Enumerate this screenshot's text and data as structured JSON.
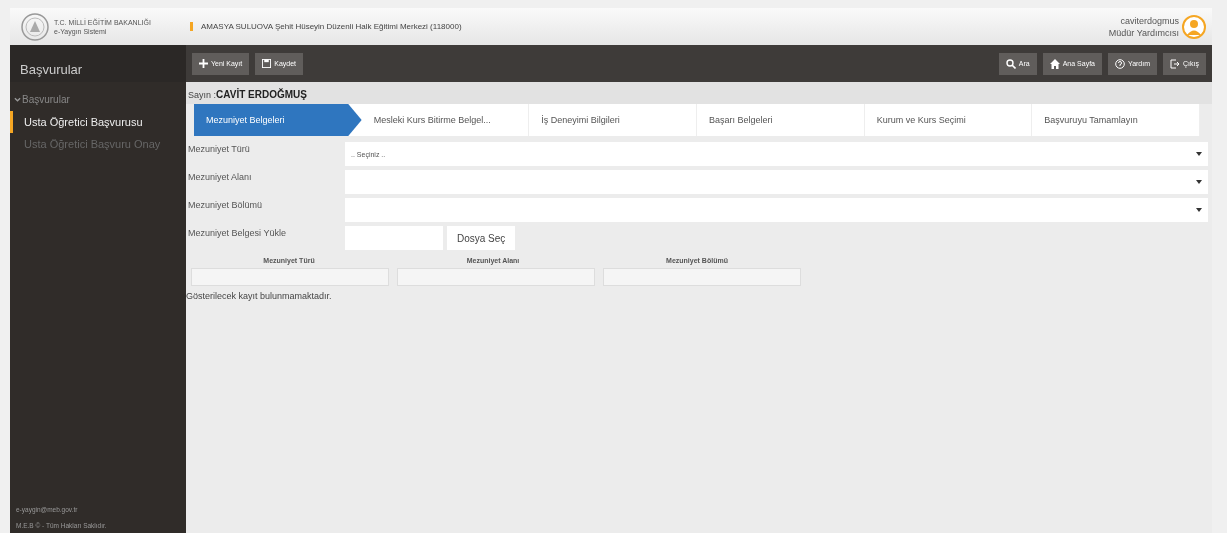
{
  "header": {
    "logo_line1": "T.C. MİLLİ EĞİTİM BAKANLIĞI",
    "logo_line2": "e-Yaygın Sistemi",
    "institution": "AMASYA SULUOVA Şehit Hüseyin Düzenli Halk Eğitimi Merkezi (118000)",
    "username": "caviterdogmus",
    "role": "Müdür Yardımcısı"
  },
  "sidebar": {
    "title": "Başvurular",
    "group": {
      "label": "Başvurular",
      "expanded": true
    },
    "items": [
      {
        "label": "Usta Öğretici Başvurusu",
        "selected": true
      },
      {
        "label": "Usta Öğretici Başvuru Onay",
        "selected": false
      }
    ],
    "footer": [
      "e-yaygin@meb.gov.tr",
      "M.E.B © - Tüm Hakları Saklıdır."
    ]
  },
  "toolbar": {
    "left": [
      {
        "kind": "plus",
        "label": "Yeni Kayıt"
      },
      {
        "kind": "save",
        "label": "Kaydet"
      }
    ],
    "right": [
      {
        "kind": "search",
        "label": "Ara"
      },
      {
        "kind": "home",
        "label": "Ana Sayfa"
      },
      {
        "kind": "help",
        "label": "Yardım"
      },
      {
        "kind": "exit",
        "label": "Çıkış"
      }
    ]
  },
  "greeting": {
    "prefix": "Sayın :",
    "name": "CAVİT ERDOĞMUŞ"
  },
  "steps": [
    {
      "label": "Mezuniyet Belgeleri",
      "selected": true
    },
    {
      "label": "Mesleki Kurs Bitirme Belgel...",
      "selected": false
    },
    {
      "label": "İş Deneyimi Bilgileri",
      "selected": false
    },
    {
      "label": "Başarı Belgeleri",
      "selected": false
    },
    {
      "label": "Kurum ve Kurs Seçimi",
      "selected": false
    },
    {
      "label": "Başvuruyu Tamamlayın",
      "selected": false
    }
  ],
  "form": [
    {
      "kind": "select",
      "label": "Mezuniyet Türü",
      "value": ".. Seçiniz .."
    },
    {
      "kind": "select",
      "label": "Mezuniyet Alanı"
    },
    {
      "kind": "select",
      "label": "Mezuniyet Bölümü"
    },
    {
      "kind": "file",
      "label": "Mezuniyet Belgesi Yükle",
      "button": "Dosya Seç"
    }
  ],
  "table": {
    "columns": [
      "Mezuniyet Türü",
      "Mezuniyet Alanı",
      "Mezuniyet Bölümü"
    ],
    "empty_message": "Gösterilecek kayıt bulunmamaktadır."
  }
}
